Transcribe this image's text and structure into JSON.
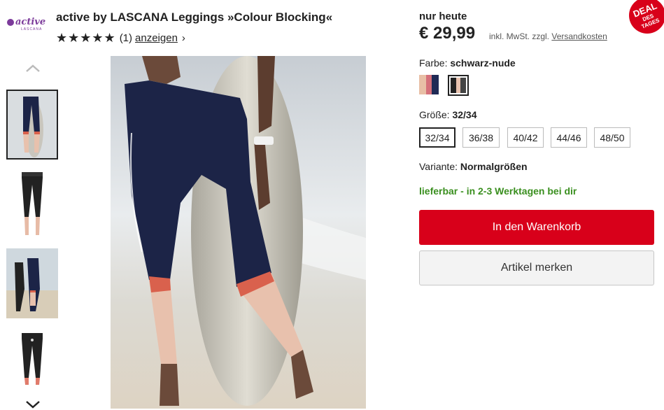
{
  "brand": {
    "logo_text": "active",
    "logo_sub": "LASCANA"
  },
  "product": {
    "title": "active by LASCANA Leggings »Colour Blocking«",
    "stars": "★★★★★",
    "rating_count": "(1)",
    "rating_link": "anzeigen",
    "rating_chevron": "›"
  },
  "pricing": {
    "label": "nur heute",
    "price": "€ 29,99",
    "tax_text": "inkl. MwSt. zzgl.",
    "shipping_link": "Versandkosten"
  },
  "deal_badge": {
    "line1": "DEAL",
    "line2": "DES",
    "line3": "TAGES"
  },
  "color": {
    "label": "Farbe:",
    "value": "schwarz-nude",
    "swatches": [
      {
        "name": "nude-navy",
        "colors": [
          "#e8bfa6",
          "#d5707a",
          "#1f2a55"
        ]
      },
      {
        "name": "schwarz-nude",
        "colors": [
          "#222222",
          "#e8c3b0",
          "#444444"
        ]
      }
    ]
  },
  "size": {
    "label": "Größe:",
    "value": "32/34",
    "options": [
      "32/34",
      "36/38",
      "40/42",
      "44/46",
      "48/50"
    ]
  },
  "variant": {
    "label": "Variante:",
    "value": "Normalgrößen"
  },
  "availability": "lieferbar - in 2-3 Werktagen bei dir",
  "buttons": {
    "cart": "In den Warenkorb",
    "save": "Artikel merken"
  },
  "colors": {
    "accent": "#d8001a",
    "availability": "#3a8f1f",
    "brand": "#7c3b9b"
  }
}
